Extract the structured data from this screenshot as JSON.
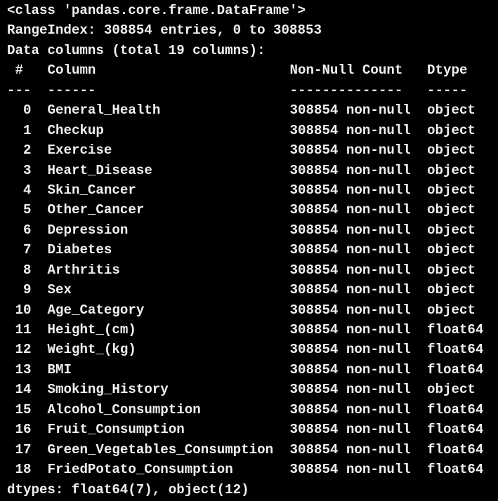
{
  "header": {
    "class_line": "<class 'pandas.core.frame.DataFrame'>",
    "range_index": "RangeIndex: 308854 entries, 0 to 308853",
    "data_columns": "Data columns (total 19 columns):"
  },
  "table": {
    "headers": [
      "#",
      "Column",
      "Non-Null Count",
      "Dtype"
    ],
    "separators": [
      "---",
      "------",
      "--------------",
      "-----"
    ],
    "rows": [
      [
        "0",
        "General_Health",
        "308854 non-null",
        "object"
      ],
      [
        "1",
        "Checkup",
        "308854 non-null",
        "object"
      ],
      [
        "2",
        "Exercise",
        "308854 non-null",
        "object"
      ],
      [
        "3",
        "Heart_Disease",
        "308854 non-null",
        "object"
      ],
      [
        "4",
        "Skin_Cancer",
        "308854 non-null",
        "object"
      ],
      [
        "5",
        "Other_Cancer",
        "308854 non-null",
        "object"
      ],
      [
        "6",
        "Depression",
        "308854 non-null",
        "object"
      ],
      [
        "7",
        "Diabetes",
        "308854 non-null",
        "object"
      ],
      [
        "8",
        "Arthritis",
        "308854 non-null",
        "object"
      ],
      [
        "9",
        "Sex",
        "308854 non-null",
        "object"
      ],
      [
        "10",
        "Age_Category",
        "308854 non-null",
        "object"
      ],
      [
        "11",
        "Height_(cm)",
        "308854 non-null",
        "float64"
      ],
      [
        "12",
        "Weight_(kg)",
        "308854 non-null",
        "float64"
      ],
      [
        "13",
        "BMI",
        "308854 non-null",
        "float64"
      ],
      [
        "14",
        "Smoking_History",
        "308854 non-null",
        "object"
      ],
      [
        "15",
        "Alcohol_Consumption",
        "308854 non-null",
        "float64"
      ],
      [
        "16",
        "Fruit_Consumption",
        "308854 non-null",
        "float64"
      ],
      [
        "17",
        "Green_Vegetables_Consumption",
        "308854 non-null",
        "float64"
      ],
      [
        "18",
        "FriedPotato_Consumption",
        "308854 non-null",
        "float64"
      ]
    ]
  },
  "footer": {
    "dtypes": "dtypes: float64(7), object(12)"
  }
}
